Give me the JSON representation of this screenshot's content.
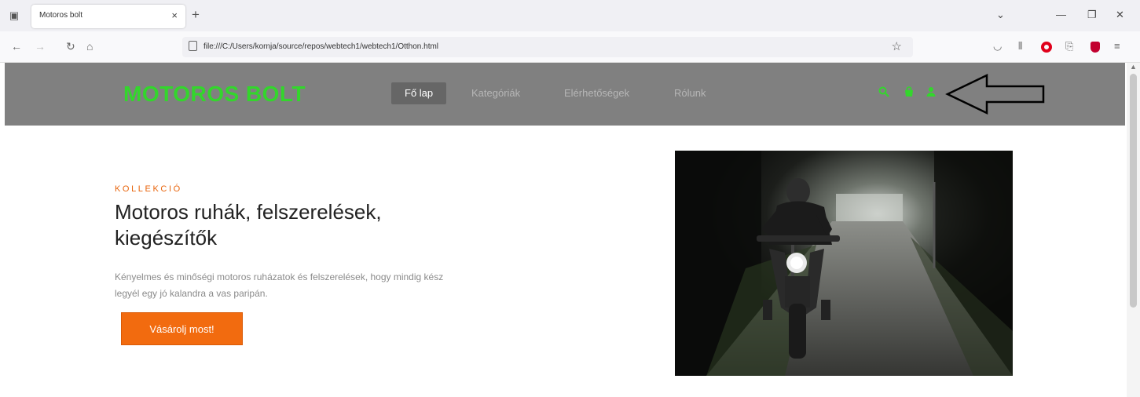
{
  "browser": {
    "tab_title": "Motoros bolt",
    "tab_close": "×",
    "new_tab": "+",
    "url": "file:///C:/Users/kornja/source/repos/webtech1/webtech1/Otthon.html"
  },
  "site": {
    "logo": "MOTOROS BOLT",
    "menu": [
      {
        "label": "Fő lap",
        "active": true
      },
      {
        "label": "Kategóriák",
        "active": false
      },
      {
        "label": "Elérhetőségek",
        "active": false
      },
      {
        "label": "Rólunk",
        "active": false
      }
    ],
    "icons": [
      "search-icon",
      "shopping-bag-icon",
      "user-icon"
    ],
    "accent_color": "#33d62c",
    "header_color": "#808080"
  },
  "hero": {
    "kicker": "KOLLEKCIÓ",
    "title": "Motoros ruhák, felszerelések, kiegészítők",
    "text": "Kényelmes és minőségi motoros ruházatok és felszerelések, hogy mindig kész legyél egy jó kalandra a vas paripán.",
    "cta": "Vásárolj most!",
    "cta_color": "#f26b0f",
    "image": "motorcyclist riding on a tree-lined road"
  }
}
